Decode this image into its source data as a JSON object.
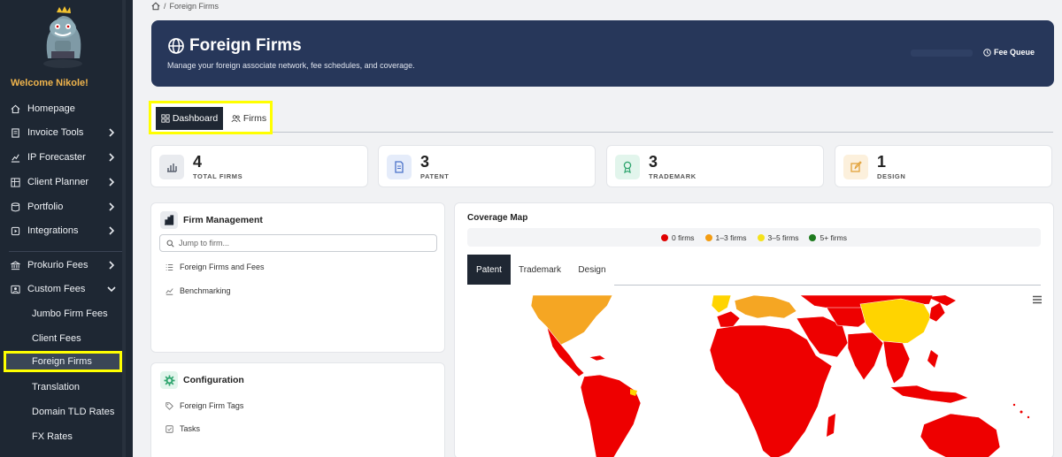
{
  "sidebar": {
    "welcome": "Welcome Nikole!",
    "items": [
      {
        "label": "Homepage",
        "icon": "home-icon",
        "chevron": false
      },
      {
        "label": "Invoice Tools",
        "icon": "invoice-icon",
        "chevron": true
      },
      {
        "label": "IP Forecaster",
        "icon": "chart-icon",
        "chevron": true
      },
      {
        "label": "Client Planner",
        "icon": "grid-icon",
        "chevron": true
      },
      {
        "label": "Portfolio",
        "icon": "database-icon",
        "chevron": true
      },
      {
        "label": "Integrations",
        "icon": "plugin-icon",
        "chevron": true
      },
      {
        "label": "Prokurio Fees",
        "icon": "bank-icon",
        "chevron": true
      },
      {
        "label": "Custom Fees",
        "icon": "user-card-icon",
        "chevron": true,
        "expanded": true
      }
    ],
    "subitems": [
      "Jumbo Firm Fees",
      "Client Fees",
      "Foreign Firms",
      "Translation",
      "Domain TLD Rates",
      "FX Rates"
    ],
    "active_sub": "Foreign Firms"
  },
  "breadcrumb": {
    "separator": "/",
    "current": "Foreign Firms"
  },
  "hero": {
    "title": "Foreign Firms",
    "subtitle": "Manage your foreign associate network, fee schedules, and coverage.",
    "fee_queue": "Fee Queue"
  },
  "tabs": {
    "dashboard": "Dashboard",
    "firms": "Firms"
  },
  "stats": [
    {
      "value": "4",
      "label": "TOTAL FIRMS",
      "icon": "bar-chart-icon",
      "bg": "#e9ebef",
      "fg": "#5a6270"
    },
    {
      "value": "3",
      "label": "PATENT",
      "icon": "document-icon",
      "bg": "#e5ecfa",
      "fg": "#4a72c9"
    },
    {
      "value": "3",
      "label": "TRADEMARK",
      "icon": "award-icon",
      "bg": "#e2f5ec",
      "fg": "#2fa56e"
    },
    {
      "value": "1",
      "label": "DESIGN",
      "icon": "edit-icon",
      "bg": "#fcf0dc",
      "fg": "#e2a23a"
    }
  ],
  "firm_management": {
    "title": "Firm Management",
    "search_placeholder": "Jump to firm...",
    "links": [
      "Foreign Firms and Fees",
      "Benchmarking"
    ]
  },
  "configuration": {
    "title": "Configuration",
    "links": [
      "Foreign Firm Tags",
      "Tasks"
    ]
  },
  "coverage_map": {
    "title": "Coverage Map",
    "legend": [
      {
        "label": "0 firms",
        "color": "#e00000"
      },
      {
        "label": "1–3 firms",
        "color": "#f39c12"
      },
      {
        "label": "3–5 firms",
        "color": "#f5e21b"
      },
      {
        "label": "5+ firms",
        "color": "#1e7a1e"
      }
    ],
    "tabs": [
      "Patent",
      "Trademark",
      "Design"
    ],
    "active_tab": "Patent"
  },
  "colors": {
    "sidebar": "#1e2733",
    "hero": "#27375a",
    "highlight": "#ffff00",
    "map_zero": "#ee0000",
    "map_low": "#f5a623",
    "map_mid": "#ffd400"
  }
}
